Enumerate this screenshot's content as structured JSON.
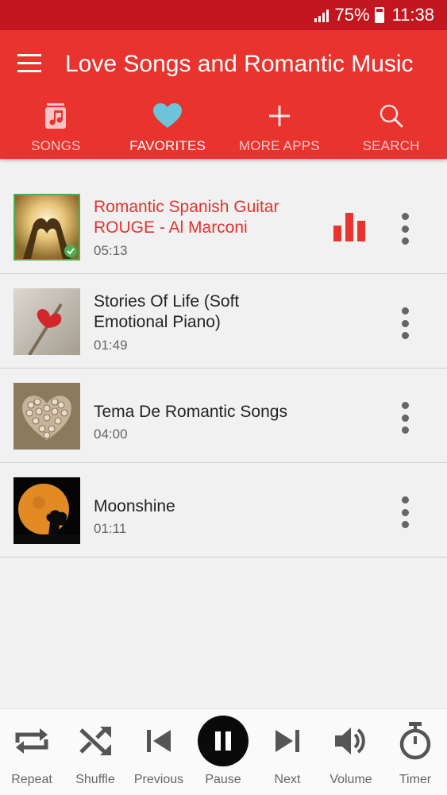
{
  "status_bar": {
    "battery": "75%",
    "time": "11:38"
  },
  "app_bar": {
    "title": "Love Songs and Romantic Music"
  },
  "tabs": [
    {
      "label": "SONGS",
      "icon": "music-file-icon",
      "active": false
    },
    {
      "label": "FAVORITES",
      "icon": "heart-icon",
      "active": true
    },
    {
      "label": "MORE APPS",
      "icon": "plus-icon",
      "active": false
    },
    {
      "label": "SEARCH",
      "icon": "search-icon",
      "active": false
    }
  ],
  "songs": [
    {
      "title": "Romantic Spanish Guitar ROUGE - Al Marconi",
      "duration": "05:13",
      "playing": true
    },
    {
      "title": "Stories Of Life (Soft Emotional Piano)",
      "duration": "01:49",
      "playing": false
    },
    {
      "title": "Tema De Romantic Songs",
      "duration": "04:00",
      "playing": false
    },
    {
      "title": "Moonshine",
      "duration": "01:11",
      "playing": false
    }
  ],
  "player": {
    "repeat": "Repeat",
    "shuffle": "Shuffle",
    "previous": "Previous",
    "pause": "Pause",
    "next": "Next",
    "volume": "Volume",
    "timer": "Timer"
  },
  "colors": {
    "accent": "#e8332f",
    "status_bar": "#c4161f",
    "favorite": "#6cc4d8"
  }
}
